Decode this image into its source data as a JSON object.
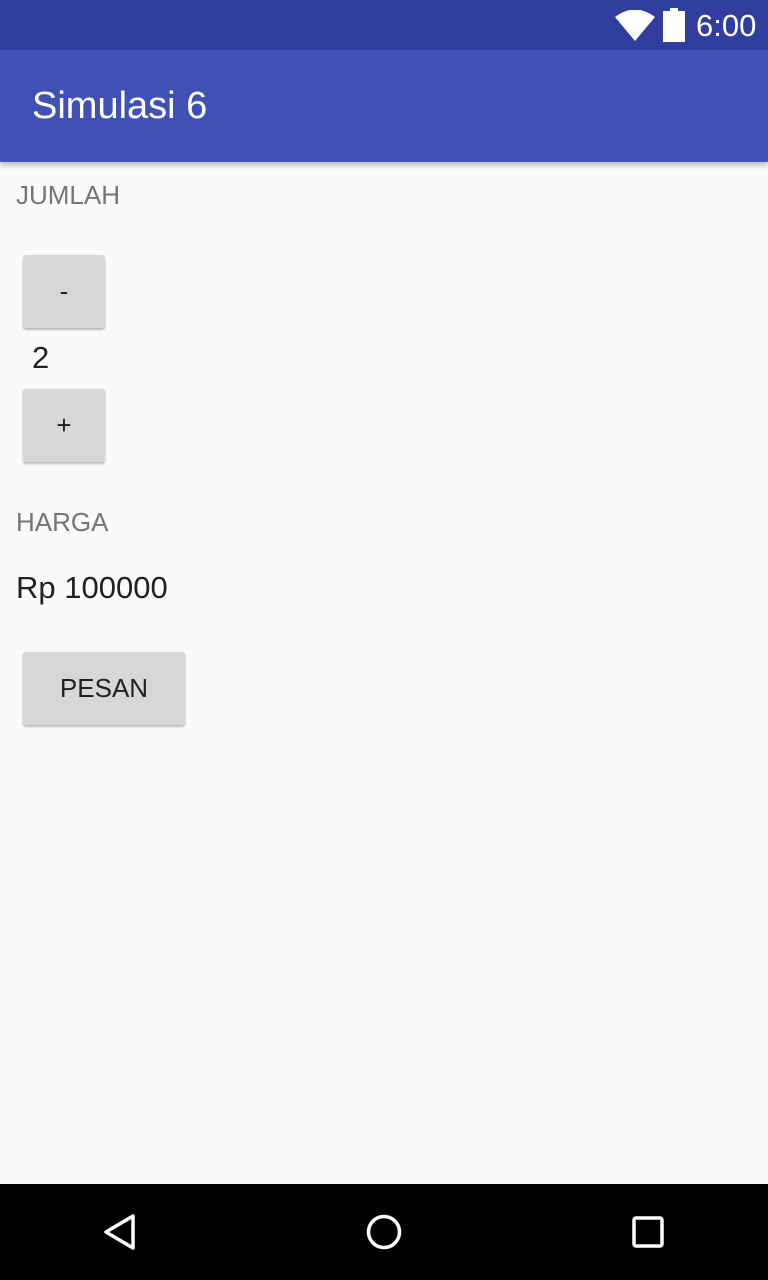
{
  "status_bar": {
    "time": "6:00",
    "icons": [
      "wifi-icon",
      "battery-icon"
    ]
  },
  "app_bar": {
    "title": "Simulasi 6"
  },
  "quantity_section": {
    "label": "JUMLAH",
    "decrement_label": "-",
    "value": "2",
    "increment_label": "+"
  },
  "price_section": {
    "label": "HARGA",
    "value": "Rp 100000"
  },
  "order_button": {
    "label": "PESAN"
  },
  "nav_bar": {
    "icons": [
      "back-icon",
      "home-icon",
      "recents-icon"
    ]
  },
  "colors": {
    "status_bar": "#303f9f",
    "app_bar": "#3f51b5",
    "background": "#fafafa",
    "button": "#d6d7d7",
    "label_text": "#757575",
    "body_text": "#212121",
    "nav_bar": "#000000"
  }
}
